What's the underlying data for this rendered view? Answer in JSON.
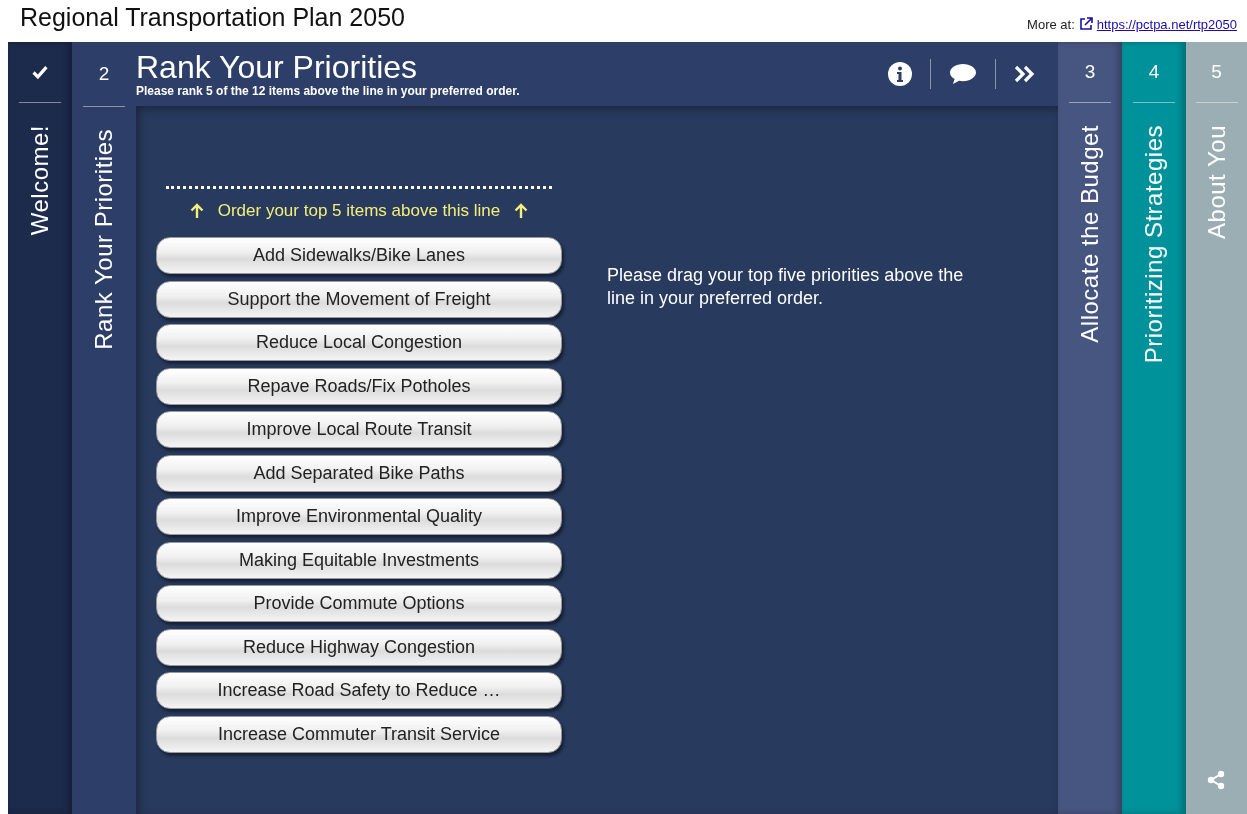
{
  "page_title": "Regional Transportation Plan 2050",
  "more_at": {
    "label": "More at:",
    "link": "https://pctpa.net/rtp2050"
  },
  "steps": [
    {
      "kind": "done",
      "label": "Welcome!",
      "selected": false,
      "color": "#1c2a4b"
    },
    {
      "kind": "numbered",
      "number": "2",
      "label": "Rank Your Priorities",
      "selected": true,
      "color": "#2d3f68"
    },
    {
      "kind": "numbered",
      "number": "3",
      "label": "Allocate the Budget",
      "selected": false,
      "color": "#475681"
    },
    {
      "kind": "numbered",
      "number": "4",
      "label": "Prioritizing Strategies",
      "selected": false,
      "color": "#00929b"
    },
    {
      "kind": "numbered",
      "number": "5",
      "label": "About You",
      "selected": false,
      "color": "#9aaeb3"
    }
  ],
  "panel": {
    "title": "Rank Your Priorities",
    "subtitle": "Please rank 5 of the 12 items above the line in your preferred order.",
    "line_hint": "Order your top 5 items above this line",
    "items": [
      "Add Sidewalks/Bike Lanes",
      "Support the Movement of Freight",
      "Reduce Local Congestion",
      "Repave Roads/Fix Potholes",
      "Improve Local Route Transit",
      "Add Separated Bike Paths",
      "Improve Environmental Quality",
      "Making Equitable Investments",
      "Provide Commute Options",
      "Reduce Highway Congestion",
      "Increase Road Safety to Reduce …",
      "Increase Commuter Transit Service"
    ],
    "instructions": "Please drag your top five priorities above the line in your preferred order."
  }
}
